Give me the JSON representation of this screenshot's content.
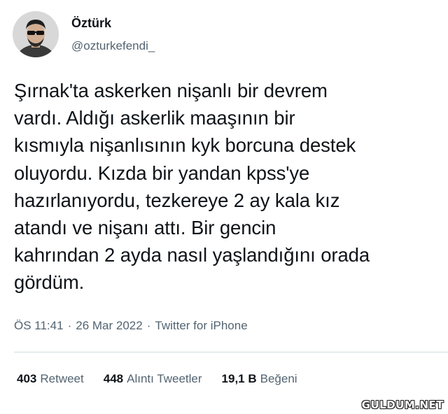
{
  "user": {
    "display_name": "Öztürk",
    "handle": "@ozturkefendi_"
  },
  "tweet": {
    "text": "Şırnak'ta askerken nişanlı bir devrem\nvardı. Aldığı askerlik maaşının bir\nkısmıyla nişanlısının kyk borcuna destek\noluyordu. Kızda bir yandan kpss'ye\nhazırlanıyordu, tezkereye 2 ay kala kız\natandı ve nişanı attı. Bir gencin\nkahrından 2 ayda nasıl yaşlandığını orada\ngördüm."
  },
  "meta": {
    "time": "ÖS 11:41",
    "separator": "·",
    "date": "26 Mar 2022",
    "source": "Twitter for iPhone"
  },
  "stats": {
    "retweets_count": "403",
    "retweets_label": "Retweet",
    "quotes_count": "448",
    "quotes_label": "Alıntı Tweetler",
    "likes_count": "19,1 B",
    "likes_label": "Beğeni"
  },
  "watermark": "GULDUM.NET",
  "colors": {
    "text": "#0f1419",
    "secondary": "#536471",
    "divider": "#cfd9de"
  }
}
